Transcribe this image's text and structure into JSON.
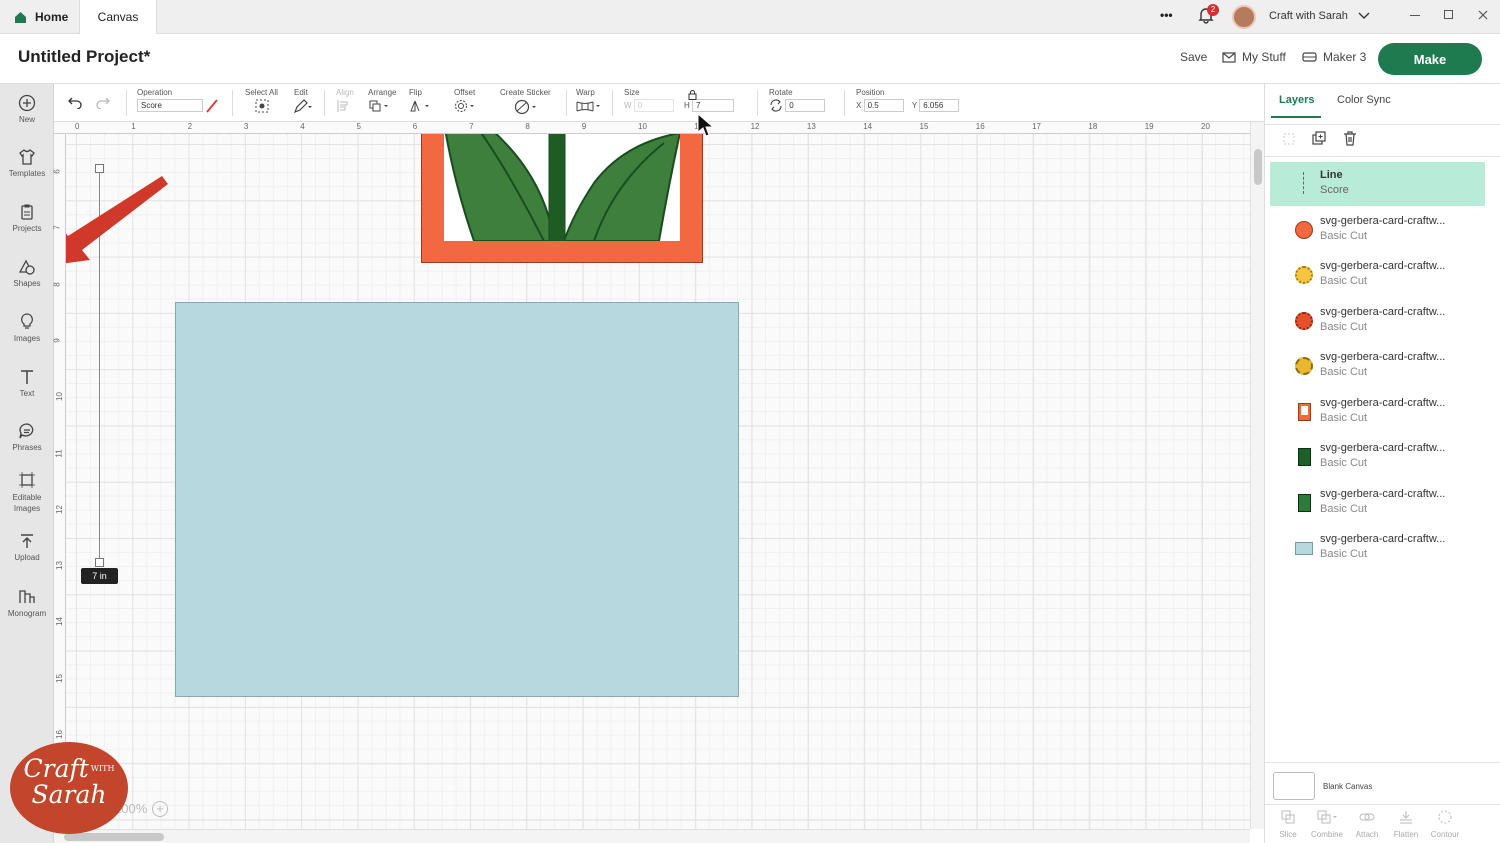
{
  "tabs": {
    "home": "Home",
    "canvas": "Canvas"
  },
  "topbar": {
    "more": "•••",
    "notifications": "2",
    "account": "Craft with Sarah"
  },
  "header": {
    "title": "Untitled Project*",
    "save": "Save",
    "my_stuff": "My Stuff",
    "machine": "Maker 3",
    "make": "Make"
  },
  "leftbar": [
    {
      "label": "New",
      "icon": "plus-circle-icon"
    },
    {
      "label": "Templates",
      "icon": "shirt-icon"
    },
    {
      "label": "Projects",
      "icon": "clipboard-icon"
    },
    {
      "label": "Shapes",
      "icon": "shapes-icon"
    },
    {
      "label": "Images",
      "icon": "lightbulb-icon"
    },
    {
      "label": "Text",
      "icon": "text-icon"
    },
    {
      "label": "Phrases",
      "icon": "speech-bubble-icon"
    },
    {
      "label": "Editable Images",
      "icon": "editable-image-icon"
    },
    {
      "label": "Upload",
      "icon": "upload-icon"
    },
    {
      "label": "Monogram",
      "icon": "monogram-icon"
    }
  ],
  "toolbar": {
    "operation_label": "Operation",
    "operation_value": "Score",
    "select_all": "Select All",
    "edit": "Edit",
    "align": "Align",
    "arrange": "Arrange",
    "flip": "Flip",
    "offset": "Offset",
    "create_sticker": "Create Sticker",
    "warp": "Warp",
    "size": "Size",
    "w_label": "W",
    "w_value": "0",
    "h_label": "H",
    "h_value": "7",
    "rotate": "Rotate",
    "rotate_value": "0",
    "position": "Position",
    "x_label": "X",
    "x_value": "0.5",
    "y_label": "Y",
    "y_value": "6.056"
  },
  "ruler": {
    "h": [
      "0",
      "1",
      "2",
      "3",
      "4",
      "5",
      "6",
      "7",
      "8",
      "9",
      "10",
      "11",
      "12",
      "13",
      "14",
      "15",
      "16",
      "17",
      "18",
      "19",
      "20"
    ],
    "v": [
      "6",
      "7",
      "8",
      "9",
      "10",
      "11",
      "12",
      "13",
      "14",
      "15",
      "16"
    ]
  },
  "canvas": {
    "measure": "7 in",
    "zoom": "100%"
  },
  "panel": {
    "tab_layers": "Layers",
    "tab_color_sync": "Color Sync",
    "blank_canvas": "Blank Canvas",
    "layers": [
      {
        "name": "Line",
        "op": "Score",
        "color": "#b9ecd8"
      },
      {
        "name": "svg-gerbera-card-craftw...",
        "op": "Basic Cut",
        "color": "#f26840"
      },
      {
        "name": "svg-gerbera-card-craftw...",
        "op": "Basic Cut",
        "color": "#f5c542"
      },
      {
        "name": "svg-gerbera-card-craftw...",
        "op": "Basic Cut",
        "color": "#e8502a"
      },
      {
        "name": "svg-gerbera-card-craftw...",
        "op": "Basic Cut",
        "color": "#e8b830"
      },
      {
        "name": "svg-gerbera-card-craftw...",
        "op": "Basic Cut",
        "color": "#f26840"
      },
      {
        "name": "svg-gerbera-card-craftw...",
        "op": "Basic Cut",
        "color": "#1e5e28"
      },
      {
        "name": "svg-gerbera-card-craftw...",
        "op": "Basic Cut",
        "color": "#2d7a3a"
      },
      {
        "name": "svg-gerbera-card-craftw...",
        "op": "Basic Cut",
        "color": "#b8d8e0"
      }
    ],
    "bottom": [
      "Slice",
      "Combine",
      "Attach",
      "Flatten",
      "Contour"
    ]
  },
  "logo": {
    "line1": "Craft",
    "with": "WITH",
    "line2": "Sarah"
  },
  "colors": {
    "make": "#1e7b4f",
    "frame": "#f26840",
    "card": "#b8d8e0",
    "arrow": "#d0392a"
  }
}
